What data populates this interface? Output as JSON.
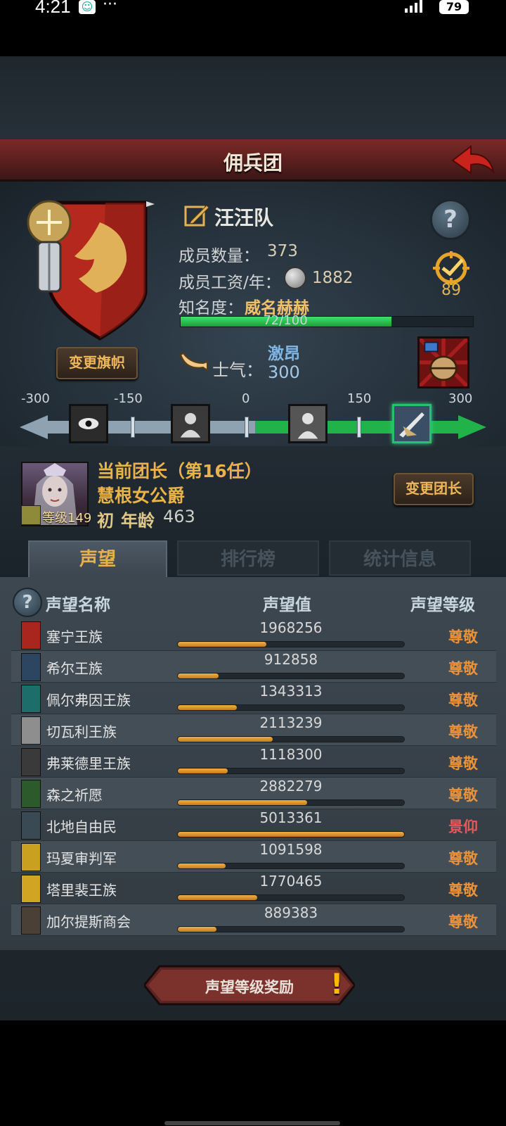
{
  "status_bar": {
    "time": "4:21",
    "dots": "···",
    "battery": "79"
  },
  "header": {
    "title": "佣兵团"
  },
  "company": {
    "name": "汪汪队",
    "members_label": "成员数量：",
    "members_value": "373",
    "wage_label": "成员工资/年：",
    "wage_value": "1882",
    "fame_label": "知名度：",
    "fame_value": "威名赫赫",
    "fame_progress_text": "72/100",
    "fame_progress": 0.72,
    "badge_value": "89",
    "change_flag_button": "变更旗帜",
    "help_symbol": "?"
  },
  "morale": {
    "label": "士气：",
    "state": "激昂",
    "value": "300",
    "scale": {
      "ticks": [
        "-300",
        "-150",
        "0",
        "150",
        "300"
      ],
      "current": 300,
      "range": [
        -300,
        300
      ]
    }
  },
  "leader": {
    "title": "当前团长（第16任）",
    "name": "慧根女公爵",
    "level_label": "等级149",
    "rank": "初",
    "age_label": "年龄",
    "age": "463",
    "change_button": "变更团长"
  },
  "tabs": [
    {
      "label": "声望",
      "active": true
    },
    {
      "label": "排行榜",
      "active": false
    },
    {
      "label": "统计信息",
      "active": false
    }
  ],
  "reputation": {
    "help_symbol": "?",
    "columns": [
      "声望名称",
      "声望值",
      "声望等级"
    ],
    "max": 5013361,
    "rows": [
      {
        "name": "塞宁王族",
        "value": "1968256",
        "level": "尊敬",
        "fill": 0.39,
        "color": "#a8261e"
      },
      {
        "name": "希尔王族",
        "value": "912858",
        "level": "尊敬",
        "fill": 0.18,
        "color": "#2c4560"
      },
      {
        "name": "佩尔弗因王族",
        "value": "1343313",
        "level": "尊敬",
        "fill": 0.26,
        "color": "#1d6d6a"
      },
      {
        "name": "切瓦利王族",
        "value": "2113239",
        "level": "尊敬",
        "fill": 0.42,
        "color": "#8e8e8e"
      },
      {
        "name": "弗莱德里王族",
        "value": "1118300",
        "level": "尊敬",
        "fill": 0.22,
        "color": "#3a3a3a"
      },
      {
        "name": "森之祈愿",
        "value": "2882279",
        "level": "尊敬",
        "fill": 0.57,
        "color": "#2d5a2a"
      },
      {
        "name": "北地自由民",
        "value": "5013361",
        "level": "景仰",
        "fill": 1.0,
        "color": "#3a4a55"
      },
      {
        "name": "玛夏审判军",
        "value": "1091598",
        "level": "尊敬",
        "fill": 0.21,
        "color": "#c9a020"
      },
      {
        "name": "塔里裴王族",
        "value": "1770465",
        "level": "尊敬",
        "fill": 0.35,
        "color": "#d1a424"
      },
      {
        "name": "加尔提斯商会",
        "value": "889383",
        "level": "尊敬",
        "fill": 0.17,
        "color": "#4a4036"
      }
    ]
  },
  "reward_button": {
    "label": "声望等级奖励",
    "alert": "!"
  }
}
